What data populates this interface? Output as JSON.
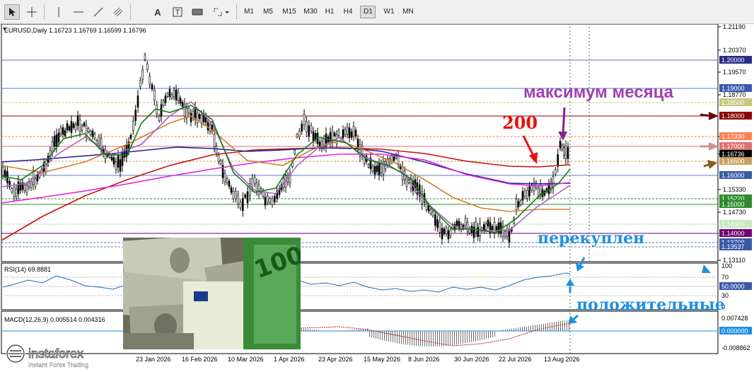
{
  "toolbar": {
    "tools": [
      "cursor-icon",
      "crosshair-icon",
      "vertical-line-icon",
      "horizontal-line-icon",
      "trendline-icon",
      "channel-icon",
      "text-icon",
      "text-label-icon",
      "rectangle-icon",
      "shapes-dropdown-icon"
    ],
    "text_tool_label": "A",
    "timeframes": [
      "M1",
      "M5",
      "M15",
      "M30",
      "H1",
      "H4",
      "D1",
      "W1",
      "MN"
    ],
    "active_timeframe": "D1"
  },
  "chart": {
    "header": "EURUSD,Daily  1.16723 1.16769 1.16599 1.16796",
    "price_ticks": [
      "1.21190",
      "1.20370",
      "1.19570",
      "1.18770",
      "1.17330",
      "1.16736",
      "1.15330",
      "1.14730",
      "1.13110"
    ],
    "level_labels": [
      {
        "text": "1.20000",
        "bg": "#2a2a8a"
      },
      {
        "text": "1.19000",
        "bg": "#3a5aa8"
      },
      {
        "text": "1.18500",
        "bg": "#c8c880"
      },
      {
        "text": "1.18000",
        "bg": "#8b0000"
      },
      {
        "text": "1.17330",
        "bg": "#ff7f50"
      },
      {
        "text": "1.17000",
        "bg": "#e07070"
      },
      {
        "text": "1.16736",
        "bg": "#000000"
      },
      {
        "text": "1.16500",
        "bg": "#c8a060"
      },
      {
        "text": "1.16000",
        "bg": "#3a5aa8"
      },
      {
        "text": "1.15220",
        "bg": "#2e8b2e"
      },
      {
        "text": "1.15000",
        "bg": "#2e8b2e"
      },
      {
        "text": "1.14300",
        "bg": "#c8e8c0"
      },
      {
        "text": "1.14000",
        "bg": "#700070"
      },
      {
        "text": "1.13700",
        "bg": "#3a5aa8"
      },
      {
        "text": "1.13537",
        "bg": "#3a5aa8"
      }
    ],
    "dates": [
      "23 Jan 2026",
      "16 Feb 2026",
      "10 Mar 2026",
      "1 Apr 2026",
      "23 Apr 2026",
      "15 May 2026",
      "8 Jun 2026",
      "30 Jun 2026",
      "22 Jul 2026",
      "13 Aug 2026"
    ]
  },
  "annotations": {
    "month_high": "максимум месяца",
    "ma200": "200",
    "overbought": "перекуплен",
    "positive": "положительные"
  },
  "rsi": {
    "header": "RSI(14) 69.8881",
    "ticks": [
      "100",
      "70",
      "50.0000",
      "30",
      "0"
    ]
  },
  "macd": {
    "header": "MACD(12,26,9) 0.005514 0.004316",
    "ticks": [
      "0.007428",
      "0.000000",
      "-0.008862"
    ]
  },
  "brand": {
    "name": "instaforex",
    "tagline": "Instant Forex Trading"
  },
  "colors": {
    "annotation_purple": "#a040b0",
    "annotation_red": "#e81010",
    "annotation_blue": "#2090e0"
  }
}
